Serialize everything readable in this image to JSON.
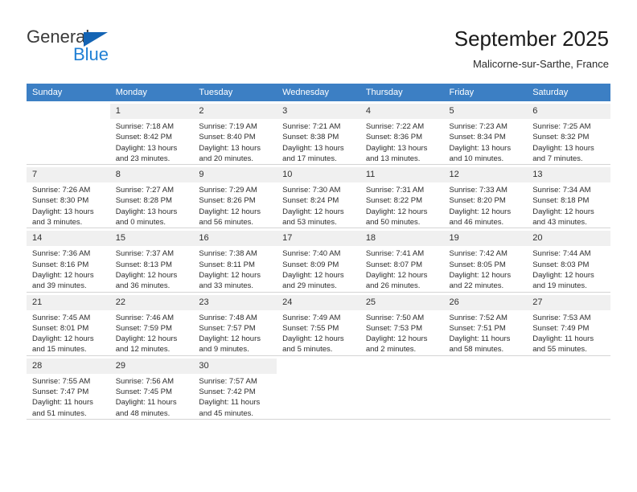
{
  "logo": {
    "word_top": "General",
    "word_bottom": "Blue",
    "triangle_icon": "triangle-icon",
    "color_dark": "#3a3a3a",
    "color_blue": "#1f7fd4"
  },
  "header": {
    "title": "September 2025",
    "subtitle": "Malicorne-sur-Sarthe, France"
  },
  "theme": {
    "header_row_bg": "#3c7fc4",
    "daynum_bg": "#f0f0f0",
    "grid_line": "#d4d4d4"
  },
  "weekdays": [
    "Sunday",
    "Monday",
    "Tuesday",
    "Wednesday",
    "Thursday",
    "Friday",
    "Saturday"
  ],
  "weeks": [
    [
      {
        "day": "",
        "lines": []
      },
      {
        "day": "1",
        "lines": [
          "Sunrise: 7:18 AM",
          "Sunset: 8:42 PM",
          "Daylight: 13 hours",
          "and 23 minutes."
        ]
      },
      {
        "day": "2",
        "lines": [
          "Sunrise: 7:19 AM",
          "Sunset: 8:40 PM",
          "Daylight: 13 hours",
          "and 20 minutes."
        ]
      },
      {
        "day": "3",
        "lines": [
          "Sunrise: 7:21 AM",
          "Sunset: 8:38 PM",
          "Daylight: 13 hours",
          "and 17 minutes."
        ]
      },
      {
        "day": "4",
        "lines": [
          "Sunrise: 7:22 AM",
          "Sunset: 8:36 PM",
          "Daylight: 13 hours",
          "and 13 minutes."
        ]
      },
      {
        "day": "5",
        "lines": [
          "Sunrise: 7:23 AM",
          "Sunset: 8:34 PM",
          "Daylight: 13 hours",
          "and 10 minutes."
        ]
      },
      {
        "day": "6",
        "lines": [
          "Sunrise: 7:25 AM",
          "Sunset: 8:32 PM",
          "Daylight: 13 hours",
          "and 7 minutes."
        ]
      }
    ],
    [
      {
        "day": "7",
        "lines": [
          "Sunrise: 7:26 AM",
          "Sunset: 8:30 PM",
          "Daylight: 13 hours",
          "and 3 minutes."
        ]
      },
      {
        "day": "8",
        "lines": [
          "Sunrise: 7:27 AM",
          "Sunset: 8:28 PM",
          "Daylight: 13 hours",
          "and 0 minutes."
        ]
      },
      {
        "day": "9",
        "lines": [
          "Sunrise: 7:29 AM",
          "Sunset: 8:26 PM",
          "Daylight: 12 hours",
          "and 56 minutes."
        ]
      },
      {
        "day": "10",
        "lines": [
          "Sunrise: 7:30 AM",
          "Sunset: 8:24 PM",
          "Daylight: 12 hours",
          "and 53 minutes."
        ]
      },
      {
        "day": "11",
        "lines": [
          "Sunrise: 7:31 AM",
          "Sunset: 8:22 PM",
          "Daylight: 12 hours",
          "and 50 minutes."
        ]
      },
      {
        "day": "12",
        "lines": [
          "Sunrise: 7:33 AM",
          "Sunset: 8:20 PM",
          "Daylight: 12 hours",
          "and 46 minutes."
        ]
      },
      {
        "day": "13",
        "lines": [
          "Sunrise: 7:34 AM",
          "Sunset: 8:18 PM",
          "Daylight: 12 hours",
          "and 43 minutes."
        ]
      }
    ],
    [
      {
        "day": "14",
        "lines": [
          "Sunrise: 7:36 AM",
          "Sunset: 8:16 PM",
          "Daylight: 12 hours",
          "and 39 minutes."
        ]
      },
      {
        "day": "15",
        "lines": [
          "Sunrise: 7:37 AM",
          "Sunset: 8:13 PM",
          "Daylight: 12 hours",
          "and 36 minutes."
        ]
      },
      {
        "day": "16",
        "lines": [
          "Sunrise: 7:38 AM",
          "Sunset: 8:11 PM",
          "Daylight: 12 hours",
          "and 33 minutes."
        ]
      },
      {
        "day": "17",
        "lines": [
          "Sunrise: 7:40 AM",
          "Sunset: 8:09 PM",
          "Daylight: 12 hours",
          "and 29 minutes."
        ]
      },
      {
        "day": "18",
        "lines": [
          "Sunrise: 7:41 AM",
          "Sunset: 8:07 PM",
          "Daylight: 12 hours",
          "and 26 minutes."
        ]
      },
      {
        "day": "19",
        "lines": [
          "Sunrise: 7:42 AM",
          "Sunset: 8:05 PM",
          "Daylight: 12 hours",
          "and 22 minutes."
        ]
      },
      {
        "day": "20",
        "lines": [
          "Sunrise: 7:44 AM",
          "Sunset: 8:03 PM",
          "Daylight: 12 hours",
          "and 19 minutes."
        ]
      }
    ],
    [
      {
        "day": "21",
        "lines": [
          "Sunrise: 7:45 AM",
          "Sunset: 8:01 PM",
          "Daylight: 12 hours",
          "and 15 minutes."
        ]
      },
      {
        "day": "22",
        "lines": [
          "Sunrise: 7:46 AM",
          "Sunset: 7:59 PM",
          "Daylight: 12 hours",
          "and 12 minutes."
        ]
      },
      {
        "day": "23",
        "lines": [
          "Sunrise: 7:48 AM",
          "Sunset: 7:57 PM",
          "Daylight: 12 hours",
          "and 9 minutes."
        ]
      },
      {
        "day": "24",
        "lines": [
          "Sunrise: 7:49 AM",
          "Sunset: 7:55 PM",
          "Daylight: 12 hours",
          "and 5 minutes."
        ]
      },
      {
        "day": "25",
        "lines": [
          "Sunrise: 7:50 AM",
          "Sunset: 7:53 PM",
          "Daylight: 12 hours",
          "and 2 minutes."
        ]
      },
      {
        "day": "26",
        "lines": [
          "Sunrise: 7:52 AM",
          "Sunset: 7:51 PM",
          "Daylight: 11 hours",
          "and 58 minutes."
        ]
      },
      {
        "day": "27",
        "lines": [
          "Sunrise: 7:53 AM",
          "Sunset: 7:49 PM",
          "Daylight: 11 hours",
          "and 55 minutes."
        ]
      }
    ],
    [
      {
        "day": "28",
        "lines": [
          "Sunrise: 7:55 AM",
          "Sunset: 7:47 PM",
          "Daylight: 11 hours",
          "and 51 minutes."
        ]
      },
      {
        "day": "29",
        "lines": [
          "Sunrise: 7:56 AM",
          "Sunset: 7:45 PM",
          "Daylight: 11 hours",
          "and 48 minutes."
        ]
      },
      {
        "day": "30",
        "lines": [
          "Sunrise: 7:57 AM",
          "Sunset: 7:42 PM",
          "Daylight: 11 hours",
          "and 45 minutes."
        ]
      },
      {
        "day": "",
        "lines": []
      },
      {
        "day": "",
        "lines": []
      },
      {
        "day": "",
        "lines": []
      },
      {
        "day": "",
        "lines": []
      }
    ]
  ]
}
